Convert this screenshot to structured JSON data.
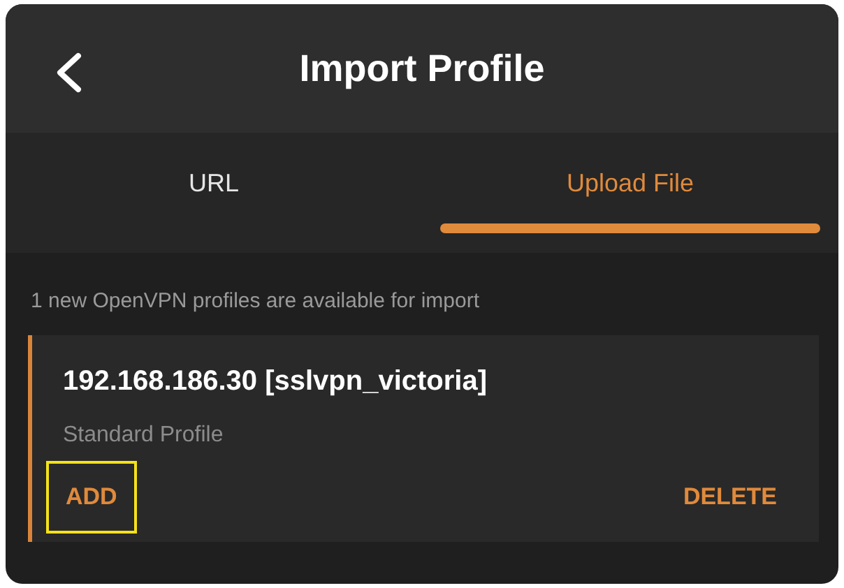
{
  "header": {
    "title": "Import Profile"
  },
  "tabs": [
    {
      "label": "URL",
      "selected": false
    },
    {
      "label": "Upload File",
      "selected": true
    }
  ],
  "notice": "1 new OpenVPN profiles are available for import",
  "profile": {
    "name": "192.168.186.30 [sslvpn_victoria]",
    "type": "Standard Profile",
    "actions": [
      {
        "label": "ADD",
        "highlighted": true
      },
      {
        "label": "DELETE",
        "highlighted": false
      }
    ]
  }
}
